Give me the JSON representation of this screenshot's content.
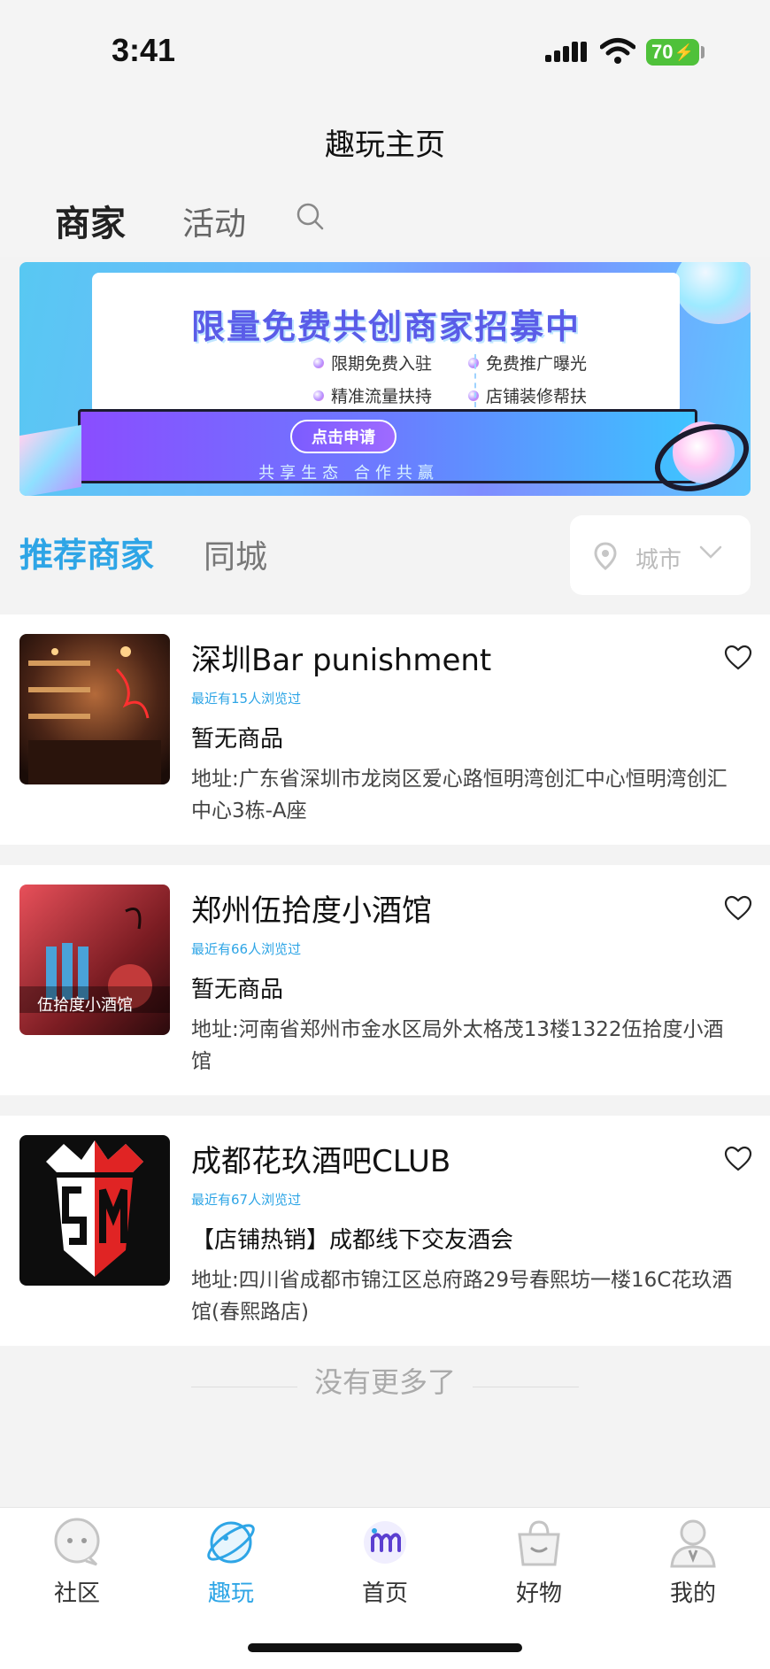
{
  "status_bar": {
    "time": "3:41",
    "battery": "70"
  },
  "header": {
    "title": "趣玩主页"
  },
  "top_tabs": {
    "merchant": "商家",
    "activity": "活动"
  },
  "banner": {
    "headline": "限量免费共创商家招募中",
    "points": [
      "限期免费入驻",
      "免费推广曝光",
      "精准流量扶持",
      "店铺装修帮扶"
    ],
    "button": "点击申请",
    "slogan": "共享生态 合作共赢"
  },
  "section": {
    "recommend": "推荐商家",
    "local": "同城",
    "city_placeholder": "城市"
  },
  "merchants": [
    {
      "name": "深圳Bar punishment",
      "views": "最近有15人浏览过",
      "product": "暂无商品",
      "address": "地址:广东省深圳市龙岗区爱心路恒明湾创汇中心恒明湾创汇中心3栋-A座"
    },
    {
      "name": "郑州伍拾度小酒馆",
      "views": "最近有66人浏览过",
      "product": "暂无商品",
      "address": "地址:河南省郑州市金水区局外太格茂13楼1322伍拾度小酒馆",
      "thumb_text": "伍拾度小酒馆"
    },
    {
      "name": "成都花玖酒吧CLUB",
      "views": "最近有67人浏览过",
      "product": "【店铺热销】成都线下交友酒会",
      "address": "地址:四川省成都市锦江区总府路29号春熙坊一楼16C花玖酒馆(春熙路店)"
    }
  ],
  "footer": {
    "no_more": "没有更多了"
  },
  "bottom_nav": [
    {
      "label": "社区",
      "icon": "chat-bubble-icon"
    },
    {
      "label": "趣玩",
      "icon": "planet-icon",
      "active": true
    },
    {
      "label": "首页",
      "icon": "home-logo-icon"
    },
    {
      "label": "好物",
      "icon": "shopping-bag-icon"
    },
    {
      "label": "我的",
      "icon": "user-icon"
    }
  ],
  "colors": {
    "accent": "#2ea5e6",
    "background": "#f3f3f3",
    "battery": "#4fc13a"
  }
}
